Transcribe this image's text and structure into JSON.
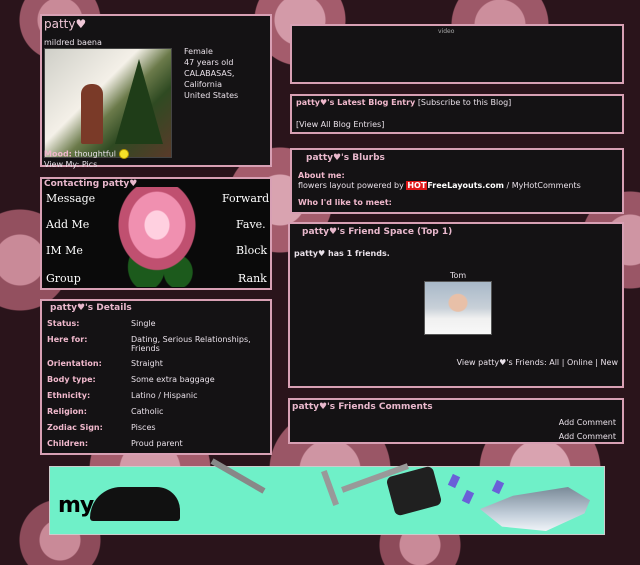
{
  "profile": {
    "name": "patty♥",
    "real_name": "mildred baena",
    "gender": "Female",
    "age": "47 years old",
    "city": "CALABASAS,",
    "state": "California",
    "country": "United States",
    "mood_label": "Mood:",
    "mood_value": "thoughtful",
    "view_my_label": "View My:",
    "pics_link": "Pics"
  },
  "contact": {
    "title": "Contacting patty♥",
    "buttons": {
      "message": "Message",
      "forward": "Forward",
      "add": "Add Me",
      "fave": "Fave.",
      "im": "IM Me",
      "block": "Block",
      "group": "Group",
      "rank": "Rank"
    }
  },
  "details": {
    "title": "patty♥'s Details",
    "rows": [
      {
        "key": "Status:",
        "value": "Single"
      },
      {
        "key": "Here for:",
        "value": "Dating, Serious Relationships, Friends"
      },
      {
        "key": "Orientation:",
        "value": "Straight"
      },
      {
        "key": "Body type:",
        "value": "Some extra baggage"
      },
      {
        "key": "Ethnicity:",
        "value": "Latino / Hispanic"
      },
      {
        "key": "Religion:",
        "value": "Catholic"
      },
      {
        "key": "Zodiac Sign:",
        "value": "Pisces"
      },
      {
        "key": "Children:",
        "value": "Proud parent"
      }
    ]
  },
  "top": {
    "video_label": "video"
  },
  "blog": {
    "title": "patty♥'s Latest Blog Entry",
    "subscribe": "[Subscribe to this Blog]",
    "view_all": "[View All Blog Entries]"
  },
  "blurbs": {
    "title": "patty♥'s Blurbs",
    "about_label": "About me:",
    "powered_prefix": "flowers layout powered by",
    "hot": "HOT",
    "site": "FreeLayouts.com",
    "sep": "/",
    "my_hot": "MyHotComments",
    "meet_label": "Who I'd like to meet:"
  },
  "friends": {
    "title": "patty♥'s Friend Space (Top 1)",
    "count_text": "patty♥ has 1 friends.",
    "friend_name": "Tom",
    "view_prefix": "View patty♥'s Friends:",
    "all": "All",
    "online": "Online",
    "new": "New",
    "pipe": "|"
  },
  "comments": {
    "title": "patty♥'s Friends Comments",
    "add1": "Add Comment",
    "add2": "Add Comment"
  },
  "banner": {
    "logo": "my"
  }
}
